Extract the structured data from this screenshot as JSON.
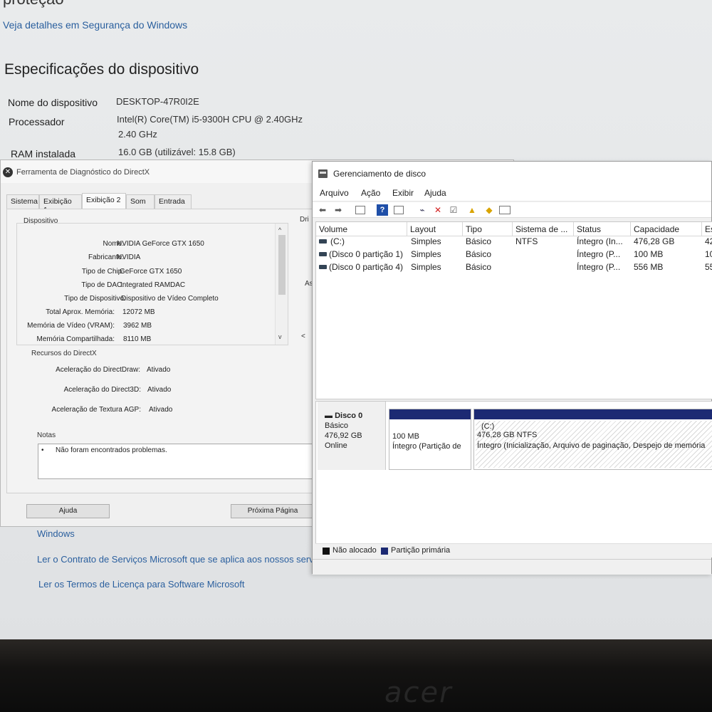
{
  "settings": {
    "cut_title": "proteção",
    "security_link": "Veja detalhes em Segurança do Windows",
    "specs_heading": "Especificações do dispositivo",
    "specs": [
      {
        "label": "Nome do dispositivo",
        "value": "DESKTOP-47R0I2E"
      },
      {
        "label": "Processador",
        "value": "Intel(R) Core(TM) i5-9300H CPU @ 2.40GHz",
        "value2": "2.40 GHz"
      },
      {
        "label": "RAM instalada",
        "value": "16.0 GB (utilizável: 15.8 GB)"
      }
    ],
    "windows_label": "Windows",
    "contract_link": "Ler o Contrato de Serviços Microsoft que se aplica aos nossos serviços",
    "license_link": "Ler os Termos de Licença para Software Microsoft"
  },
  "dxdiag": {
    "title": "Ferramenta de Diagnóstico do DirectX",
    "tabs": [
      "Sistema",
      "Exibição 1",
      "Exibição 2",
      "Som",
      "Entrada"
    ],
    "active_tab": "Exibição 2",
    "device_group": "Dispositivo",
    "drivers_group": "Dri",
    "device_rows": [
      {
        "label": "Nome:",
        "value": "NVIDIA GeForce GTX 1650"
      },
      {
        "label": "Fabricante:",
        "value": "NVIDIA"
      },
      {
        "label": "Tipo de Chip:",
        "value": "GeForce GTX 1650"
      },
      {
        "label": "Tipo de DAC:",
        "value": "Integrated RAMDAC"
      },
      {
        "label": "Tipo de Dispositivo:",
        "value": "Dispositivo de Vídeo Completo"
      },
      {
        "label": "Total Aprox. Memória:",
        "value": "12072 MB"
      },
      {
        "label": "Memória de Vídeo (VRAM):",
        "value": "3962 MB"
      },
      {
        "label": "Memória Compartilhada:",
        "value": "8110 MB"
      }
    ],
    "side_cut": "As",
    "directx_group": "Recursos do DirectX",
    "features": [
      {
        "label": "Aceleração do DirectDraw:",
        "value": "Ativado"
      },
      {
        "label": "Aceleração do Direct3D:",
        "value": "Ativado"
      },
      {
        "label": "Aceleração de Textura AGP:",
        "value": "Ativado"
      }
    ],
    "notes_group": "Notas",
    "notes_bullet": "•",
    "notes_text": "Não foram encontrados problemas.",
    "help_button": "Ajuda",
    "next_button": "Próxima Página"
  },
  "disk": {
    "title": "Gerenciamento de disco",
    "menu": [
      "Arquivo",
      "Ação",
      "Exibir",
      "Ajuda"
    ],
    "columns": [
      "Volume",
      "Layout",
      "Tipo",
      "Sistema de ...",
      "Status",
      "Capacidade",
      "Es"
    ],
    "volumes": [
      {
        "volume": "(C:)",
        "layout": "Simples",
        "tipo": "Básico",
        "fs": "NTFS",
        "status": "Íntegro (In...",
        "capacidade": "476,28 GB",
        "free": "42"
      },
      {
        "volume": "(Disco 0 partição 1)",
        "layout": "Simples",
        "tipo": "Básico",
        "fs": "",
        "status": "Íntegro (P...",
        "capacidade": "100 MB",
        "free": "10"
      },
      {
        "volume": "(Disco 0 partição 4)",
        "layout": "Simples",
        "tipo": "Básico",
        "fs": "",
        "status": "Íntegro (P...",
        "capacidade": "556 MB",
        "free": "55"
      }
    ],
    "disk0": {
      "name": "Disco 0",
      "kind": "Básico",
      "size": "476,92 GB",
      "state": "Online"
    },
    "partition1": {
      "size": "100 MB",
      "status": "Íntegro (Partição de"
    },
    "partition_c": {
      "name": "(C:)",
      "size": "476,28 GB NTFS",
      "status": "Íntegro (Inicialização, Arquivo de paginação, Despejo de memória"
    },
    "legend": [
      {
        "label": "Não alocado",
        "color": "#111111"
      },
      {
        "label": "Partição primária",
        "color": "#1c2a73"
      }
    ]
  }
}
